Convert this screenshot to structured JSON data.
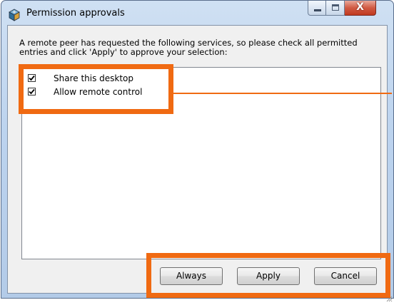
{
  "window": {
    "title": "Permission approvals",
    "controls": {
      "close_glyph": "X"
    }
  },
  "instructions": "A remote peer has requested the following services, so please check all permitted entries and click 'Apply' to approve your selection:",
  "services": [
    {
      "label": "Share this desktop",
      "checked": true
    },
    {
      "label": "Allow remote control",
      "checked": true
    }
  ],
  "buttons": {
    "always": "Always",
    "apply": "Apply",
    "cancel": "Cancel"
  },
  "colors": {
    "annotation_highlight": "#f06a12",
    "title_bar": "#bcd3ee",
    "close_button": "#c0391f"
  },
  "icons": {
    "app": "app-cube-icon",
    "minimize": "minimize-icon",
    "maximize": "maximize-icon",
    "close": "close-icon",
    "check": "checkmark-icon"
  }
}
